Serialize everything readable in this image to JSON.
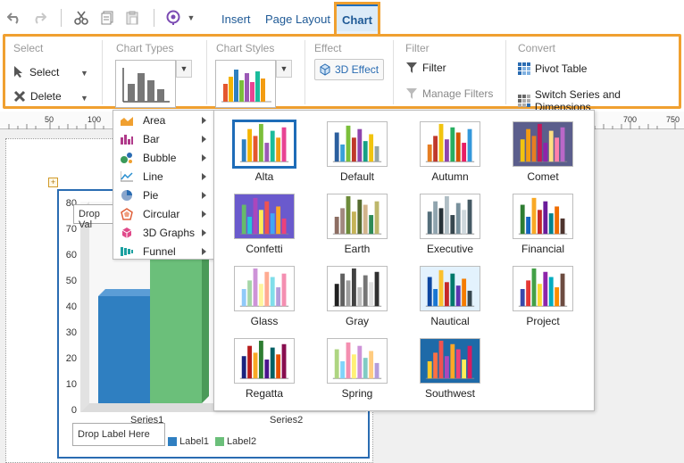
{
  "tabs": {
    "insert": "Insert",
    "page_layout": "Page Layout",
    "chart": "Chart"
  },
  "ribbon": {
    "select_group": {
      "title": "Select",
      "select_label": "Select",
      "delete_label": "Delete"
    },
    "chart_types_group": {
      "title": "Chart Types"
    },
    "chart_styles_group": {
      "title": "Chart Styles"
    },
    "effect_group": {
      "title": "Effect",
      "effect_3d_label": "3D Effect"
    },
    "filter_group": {
      "title": "Filter",
      "filter_label": "Filter",
      "manage_filters_label": "Manage Filters"
    },
    "convert_group": {
      "title": "Convert",
      "pivot_label": "Pivot Table",
      "switch_label": "Switch Series and Dimensions"
    }
  },
  "ruler": {
    "labels": [
      "50",
      "100",
      "700",
      "750"
    ]
  },
  "chart_types_menu": [
    {
      "label": "Area",
      "icon": "area-chart-icon"
    },
    {
      "label": "Bar",
      "icon": "bar-chart-icon"
    },
    {
      "label": "Bubble",
      "icon": "bubble-chart-icon"
    },
    {
      "label": "Line",
      "icon": "line-chart-icon"
    },
    {
      "label": "Pie",
      "icon": "pie-chart-icon"
    },
    {
      "label": "Circular",
      "icon": "circular-chart-icon"
    },
    {
      "label": "3D Graphs",
      "icon": "3d-graph-icon"
    },
    {
      "label": "Funnel",
      "icon": "funnel-chart-icon"
    }
  ],
  "chart_styles": [
    {
      "label": "Alta",
      "selected": true,
      "bg": "#ffffff",
      "colors": [
        "#2d7fc0",
        "#f4b400",
        "#e4572e",
        "#7bbf3a",
        "#9b59b6",
        "#1abc9c",
        "#f39c12",
        "#e84393"
      ]
    },
    {
      "label": "Default",
      "bg": "#ffffff",
      "colors": [
        "#2b5f9e",
        "#3aa0d8",
        "#7bbf3a",
        "#c0392b",
        "#8e44ad",
        "#16a085",
        "#f1c40f",
        "#95a5a6"
      ]
    },
    {
      "label": "Autumn",
      "bg": "#ffffff",
      "colors": [
        "#e67e22",
        "#c0392b",
        "#f1c40f",
        "#8e44ad",
        "#27ae60",
        "#d35400",
        "#e91e63",
        "#3498db"
      ]
    },
    {
      "label": "Comet",
      "bg": "#5b5e8c",
      "colors": [
        "#f1c40f",
        "#f39c12",
        "#e67e22",
        "#c2185b",
        "#8e24aa",
        "#ffe082",
        "#ff80ab",
        "#ba68c8"
      ]
    },
    {
      "label": "Confetti",
      "bg": "#6a5acd",
      "colors": [
        "#66bb6a",
        "#26c6da",
        "#ab47bc",
        "#ffee58",
        "#ef5350",
        "#42a5f5",
        "#ffa726",
        "#ec407a"
      ]
    },
    {
      "label": "Earth",
      "bg": "#ffffff",
      "colors": [
        "#8d6e63",
        "#a1887f",
        "#6d8b3a",
        "#c5b358",
        "#556b2f",
        "#d2b48c",
        "#2e8b57",
        "#bdb76b"
      ]
    },
    {
      "label": "Executive",
      "bg": "#ffffff",
      "colors": [
        "#546e7a",
        "#90a4ae",
        "#263238",
        "#b0bec5",
        "#37474f",
        "#78909c",
        "#cfd8dc",
        "#455a64"
      ]
    },
    {
      "label": "Financial",
      "bg": "#ffffff",
      "colors": [
        "#2e7d32",
        "#1565c0",
        "#f9a825",
        "#c62828",
        "#6a1b9a",
        "#00838f",
        "#ef6c00",
        "#4e342e"
      ]
    },
    {
      "label": "Glass",
      "bg": "#ffffff",
      "colors": [
        "#90caf9",
        "#a5d6a7",
        "#ce93d8",
        "#fff59d",
        "#ffab91",
        "#80deea",
        "#b39ddb",
        "#f48fb1"
      ]
    },
    {
      "label": "Gray",
      "bg": "#ffffff",
      "colors": [
        "#212121",
        "#616161",
        "#9e9e9e",
        "#424242",
        "#bdbdbd",
        "#757575",
        "#e0e0e0",
        "#303030"
      ]
    },
    {
      "label": "Nautical",
      "bg": "#e3f2fd",
      "colors": [
        "#0d47a1",
        "#1976d2",
        "#fbc02d",
        "#c62828",
        "#00796b",
        "#5e35b1",
        "#f57c00",
        "#37474f"
      ]
    },
    {
      "label": "Project",
      "bg": "#ffffff",
      "colors": [
        "#3949ab",
        "#e53935",
        "#43a047",
        "#fdd835",
        "#8e24aa",
        "#00acc1",
        "#fb8c00",
        "#6d4c41"
      ]
    },
    {
      "label": "Regatta",
      "bg": "#ffffff",
      "colors": [
        "#1a237e",
        "#b71c1c",
        "#f9a825",
        "#2e7d32",
        "#4a148c",
        "#006064",
        "#e65100",
        "#880e4f"
      ]
    },
    {
      "label": "Spring",
      "bg": "#ffffff",
      "colors": [
        "#aed581",
        "#81d4fa",
        "#f48fb1",
        "#fff176",
        "#ce93d8",
        "#80cbc4",
        "#ffcc80",
        "#b39ddb"
      ]
    },
    {
      "label": "Southwest",
      "bg": "#1e6aa8",
      "colors": [
        "#ffca28",
        "#ff7043",
        "#ef5350",
        "#ab47bc",
        "#ffa726",
        "#ec407a",
        "#ffee58",
        "#d81b60"
      ]
    }
  ],
  "chart_preview": {
    "y_ticks": [
      "80",
      "70",
      "60",
      "50",
      "40",
      "30",
      "20",
      "10",
      "0"
    ],
    "drop_value_text": "Drop Val",
    "drop_label_text": "Drop Label Here",
    "series_labels": [
      "Series1",
      "Series2"
    ],
    "legend": [
      {
        "label": "Label1",
        "color": "#2f7fc1"
      },
      {
        "label": "Label2",
        "color": "#6bbf7a"
      }
    ]
  }
}
